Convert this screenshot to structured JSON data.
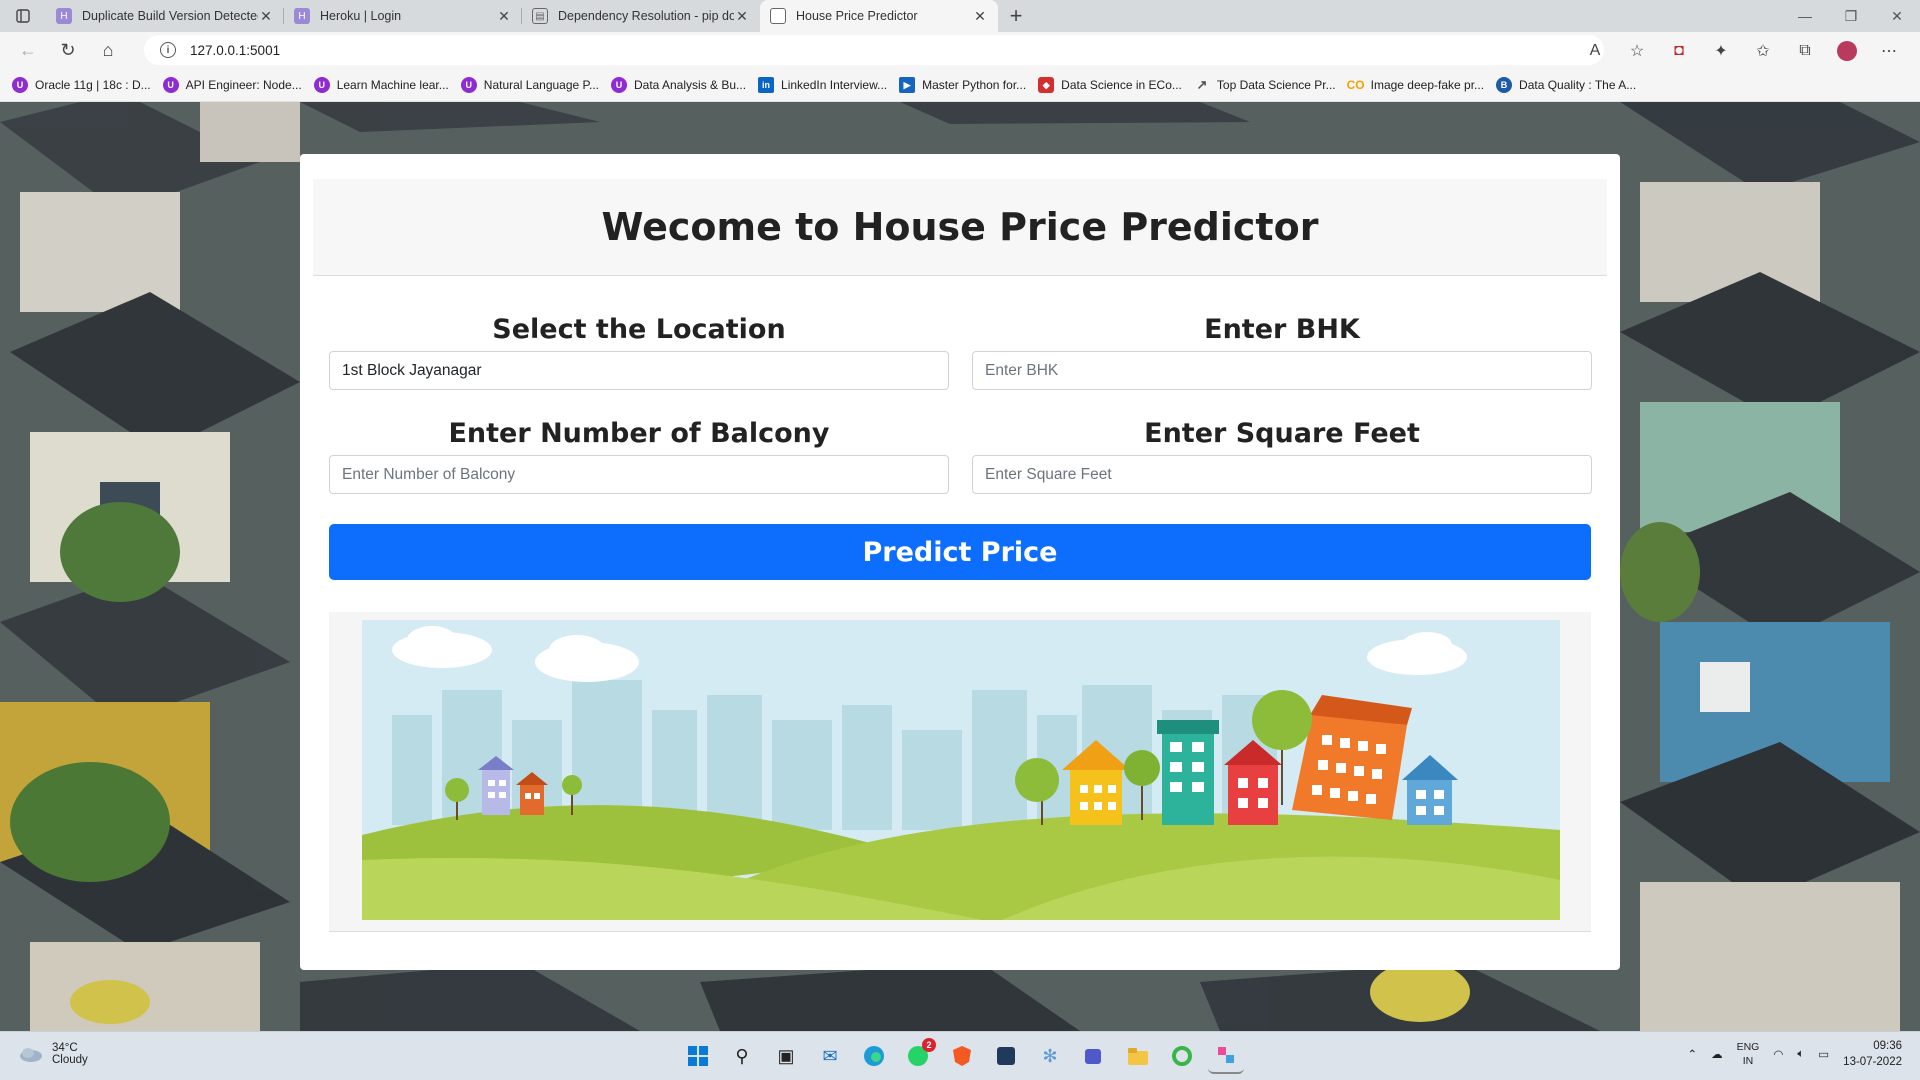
{
  "browser": {
    "tabs": [
      {
        "title": "Duplicate Build Version Detected",
        "icon": "heroku-icon"
      },
      {
        "title": "Heroku | Login",
        "icon": "heroku-icon"
      },
      {
        "title": "Dependency Resolution - pip do",
        "icon": "page-icon"
      },
      {
        "title": "House Price Predictor",
        "icon": "page-icon"
      }
    ],
    "address": "127.0.0.1:5001",
    "bookmarks": [
      {
        "label": "Oracle 11g | 18c : D...",
        "color": "#8e2bd1"
      },
      {
        "label": "API Engineer: Node...",
        "color": "#8e2bd1"
      },
      {
        "label": "Learn Machine lear...",
        "color": "#8e2bd1"
      },
      {
        "label": "Natural Language P...",
        "color": "#8e2bd1"
      },
      {
        "label": "Data Analysis & Bu...",
        "color": "#8e2bd1"
      },
      {
        "label": "LinkedIn Interview...",
        "color": "#0a66c2"
      },
      {
        "label": "Master Python for...",
        "color": "#1565c0"
      },
      {
        "label": "Data Science in ECo...",
        "color": "#d32f2f"
      },
      {
        "label": "Top Data Science Pr...",
        "color": "#555555"
      },
      {
        "label": "Image deep-fake pr...",
        "color": "#f5a300"
      },
      {
        "label": "Data Quality : The A...",
        "color": "#1e5aa8"
      }
    ]
  },
  "page": {
    "title": "Wecome to House Price Predictor",
    "location_label": "Select the Location",
    "location_value": "1st Block Jayanagar",
    "bhk_label": "Enter BHK",
    "bhk_placeholder": "Enter BHK",
    "balcony_label": "Enter Number of Balcony",
    "balcony_placeholder": "Enter Number of Balcony",
    "sqft_label": "Enter Square Feet",
    "sqft_placeholder": "Enter Square Feet",
    "predict_label": "Predict Price",
    "accent": "#0d6efd"
  },
  "taskbar": {
    "temp": "34°C",
    "weather": "Cloudy",
    "lang1": "ENG",
    "lang2": "IN",
    "time": "09:36",
    "date": "13-07-2022",
    "whatsapp_badge": "2"
  }
}
